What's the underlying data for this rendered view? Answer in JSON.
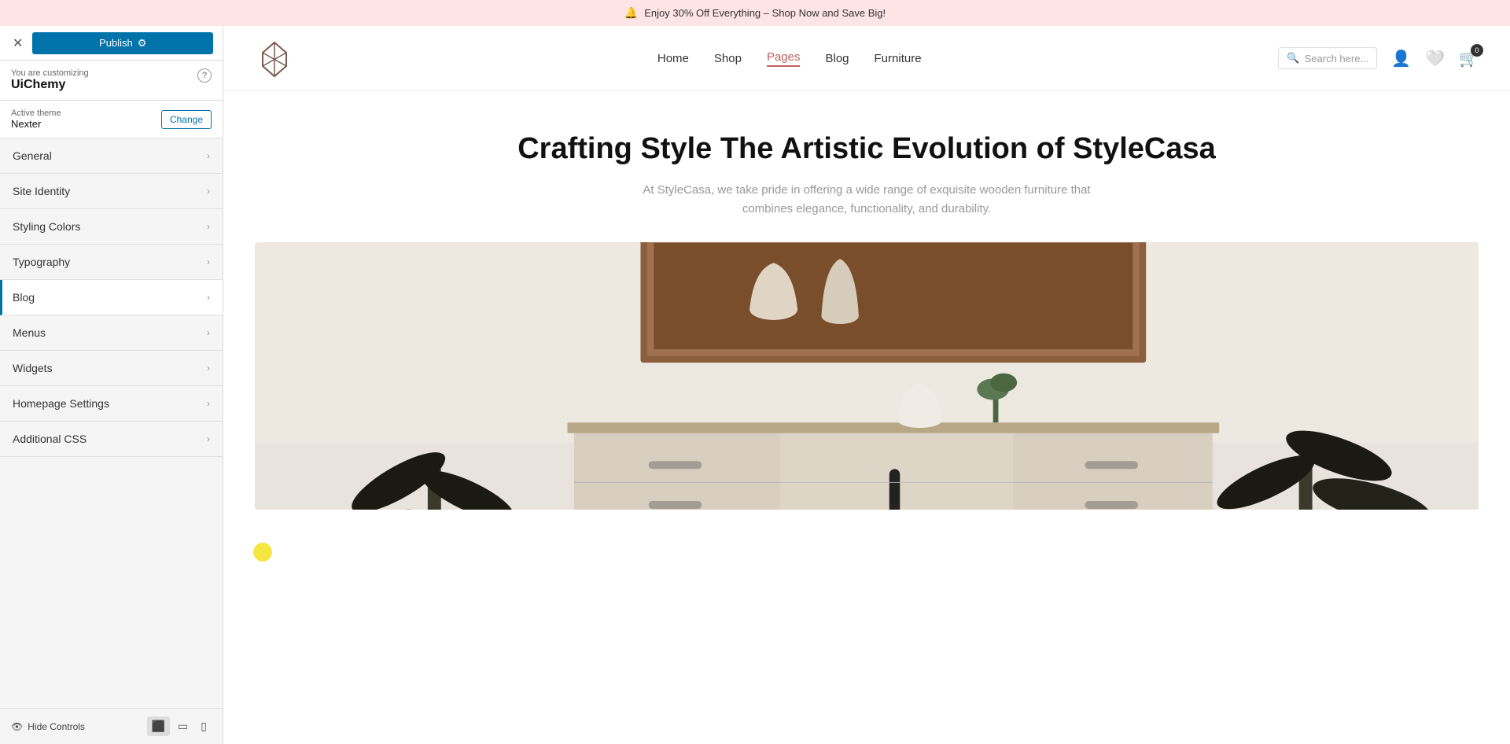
{
  "announcement": {
    "icon": "🔔",
    "text": "Enjoy 30% Off Everything – Shop Now and Save Big!"
  },
  "sidebar": {
    "close_label": "✕",
    "publish_label": "Publish",
    "publish_icon": "⚙",
    "customizing_label": "You are customizing",
    "site_name": "UiChemy",
    "help_icon": "?",
    "active_theme_label": "Active theme",
    "theme_name": "Nexter",
    "change_label": "Change",
    "nav_items": [
      {
        "id": "general",
        "label": "General",
        "active": false
      },
      {
        "id": "site-identity",
        "label": "Site Identity",
        "active": false
      },
      {
        "id": "styling-colors",
        "label": "Styling Colors",
        "active": false
      },
      {
        "id": "typography",
        "label": "Typography",
        "active": false
      },
      {
        "id": "blog",
        "label": "Blog",
        "active": true
      },
      {
        "id": "menus",
        "label": "Menus",
        "active": false
      },
      {
        "id": "widgets",
        "label": "Widgets",
        "active": false
      },
      {
        "id": "homepage-settings",
        "label": "Homepage Settings",
        "active": false
      },
      {
        "id": "additional-css",
        "label": "Additional CSS",
        "active": false
      }
    ],
    "hide_controls_label": "Hide Controls",
    "view_desktop_icon": "🖥",
    "view_tablet_icon": "📱",
    "view_mobile_icon": "📲"
  },
  "site_header": {
    "nav_items": [
      {
        "label": "Home",
        "active": false
      },
      {
        "label": "Shop",
        "active": false
      },
      {
        "label": "Pages",
        "active": true
      },
      {
        "label": "Blog",
        "active": false
      },
      {
        "label": "Furniture",
        "active": false
      }
    ],
    "search_placeholder": "Search here...",
    "cart_count": "0"
  },
  "hero": {
    "title": "Crafting Style The Artistic Evolution of StyleCasa",
    "subtitle": "At StyleCasa, we take pride in offering a wide range of exquisite wooden furniture that\ncombines elegance, functionality, and durability."
  }
}
